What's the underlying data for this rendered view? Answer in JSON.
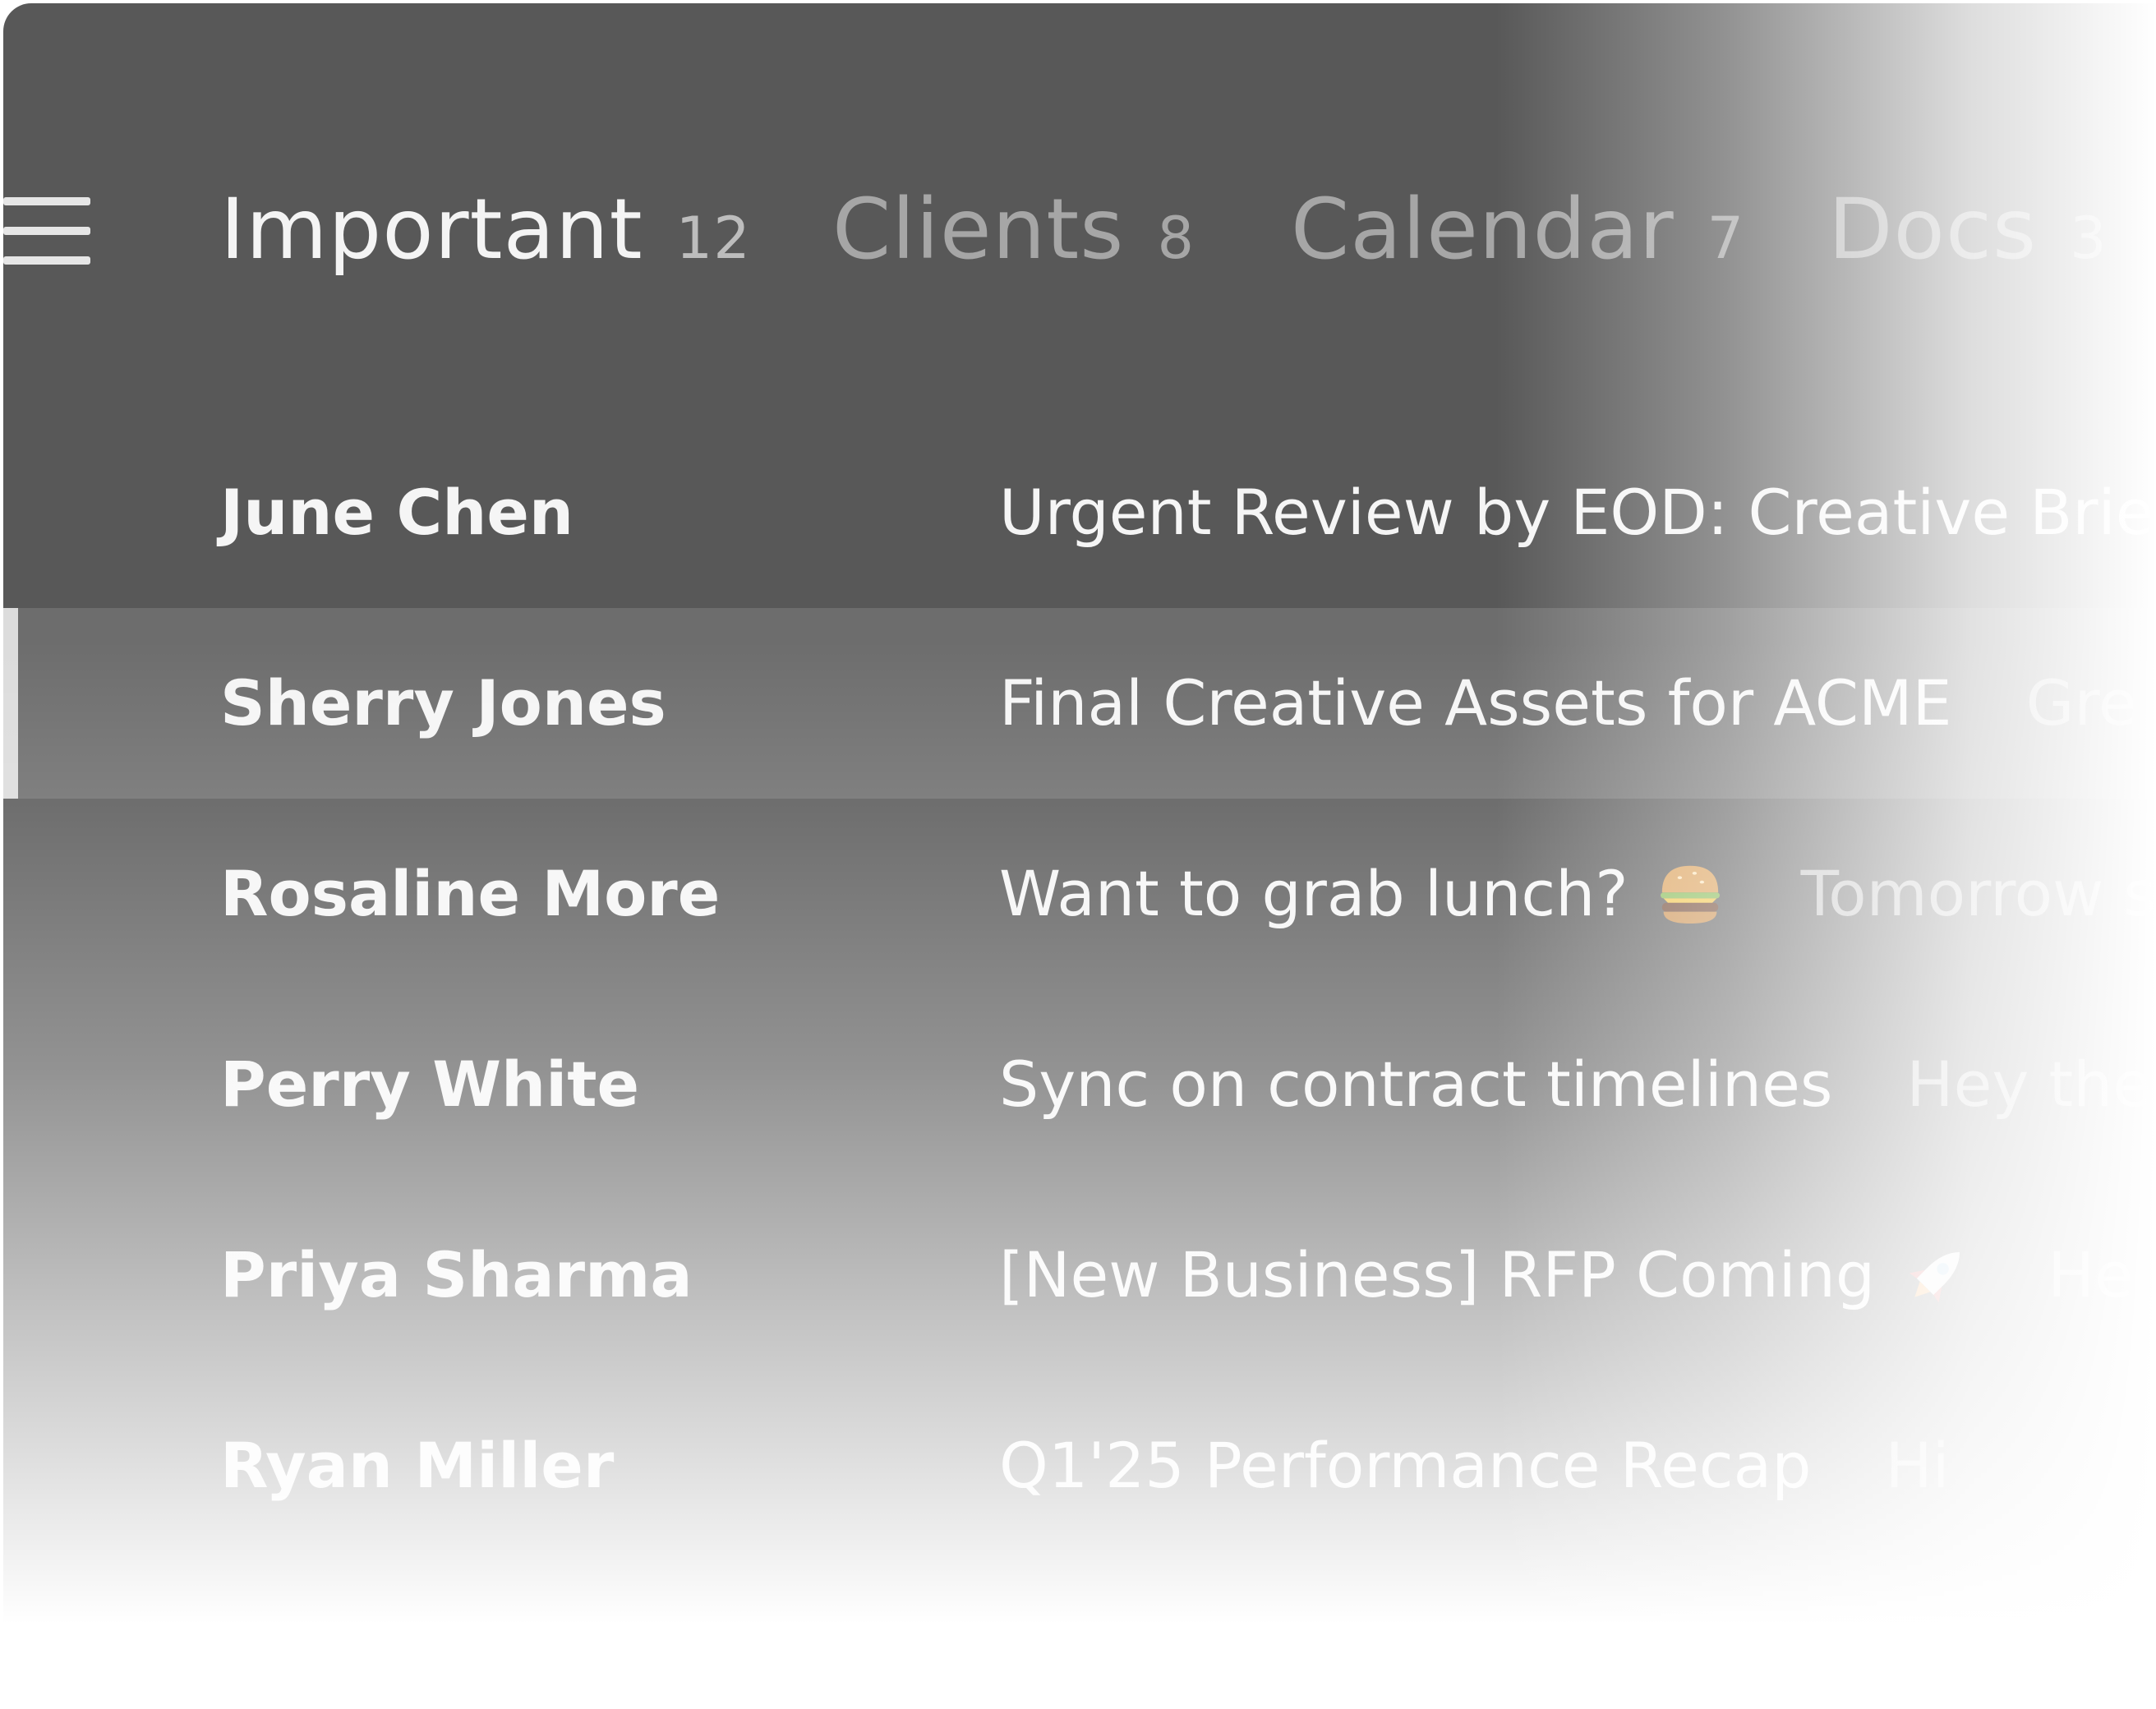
{
  "tabs": [
    {
      "label": "Important",
      "count": "12",
      "active": true
    },
    {
      "label": "Clients",
      "count": "8",
      "active": false
    },
    {
      "label": "Calendar",
      "count": "7",
      "active": false
    },
    {
      "label": "Docs",
      "count": "3",
      "active": false
    }
  ],
  "menu_icon": "hamburger-menu-icon",
  "emails": [
    {
      "sender": "June Chen",
      "subject": "Urgent Review by EOD: Creative Brief f",
      "snippet": ""
    },
    {
      "sender": "Sherry Jones",
      "subject": "Final Creative Assets for ACME",
      "snippet": "Gre",
      "selected": true
    },
    {
      "sender": "Rosaline More",
      "subject": "Want to grab lunch?",
      "emoji": "burger-icon",
      "snippet": "Tomorrow s"
    },
    {
      "sender": "Perry White",
      "subject": "Sync on contract timelines",
      "snippet": "Hey the"
    },
    {
      "sender": "Priya Sharma",
      "subject": "[New Business] RFP Coming",
      "emoji": "rocket-icon",
      "snippet": "He"
    },
    {
      "sender": "Ryan Miller",
      "subject": "Q1'25 Performance Recap",
      "snippet": "Hi"
    }
  ],
  "colors": {
    "panel_bg": "#585858",
    "active_text": "#f4f4f4",
    "inactive_text": "#a6a6a6",
    "selected_indicator": "#dcdcdc"
  }
}
